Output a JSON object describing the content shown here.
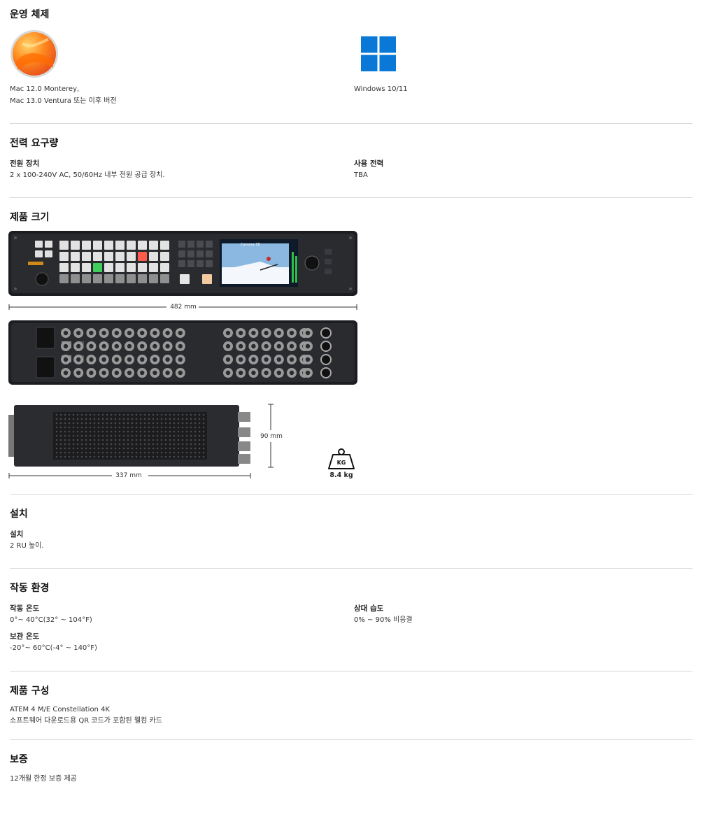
{
  "os": {
    "title": "운영 체제",
    "mac_line1": "Mac 12.0 Monterey,",
    "mac_line2": "Mac 13.0 Ventura 또는 이후 버전",
    "windows": "Windows 10/11"
  },
  "power": {
    "title": "전력 요구량",
    "supply_label": "전원 장치",
    "supply_value": "2 x 100-240V AC, 50/60Hz 내부 전원 공급 장치.",
    "usage_label": "사용 전력",
    "usage_value": "TBA"
  },
  "size": {
    "title": "제품 크기",
    "width": "482 mm",
    "height": "90 mm",
    "depth": "337 mm",
    "weight": "8.4 kg",
    "weight_icon_text": "KG",
    "screen_label": "Camera 18"
  },
  "install": {
    "title": "설치",
    "label": "설치",
    "value": "2 RU 높이."
  },
  "env": {
    "title": "작동 환경",
    "op_temp_label": "작동 온도",
    "op_temp_value": "0°~ 40°C(32° ~ 104°F)",
    "humidity_label": "상대 습도",
    "humidity_value": "0% ~ 90% 비응결",
    "storage_label": "보관 온도",
    "storage_value": "-20°~ 60°C(-4° ~ 140°F)"
  },
  "contents": {
    "title": "제품 구성",
    "line1": "ATEM 4 M/E Constellation 4K",
    "line2": "소프트웨어 다운로드용 QR 코드가 포함된 웰컴 카드"
  },
  "warranty": {
    "title": "보증",
    "value": "12개월 한정 보증 제공"
  }
}
